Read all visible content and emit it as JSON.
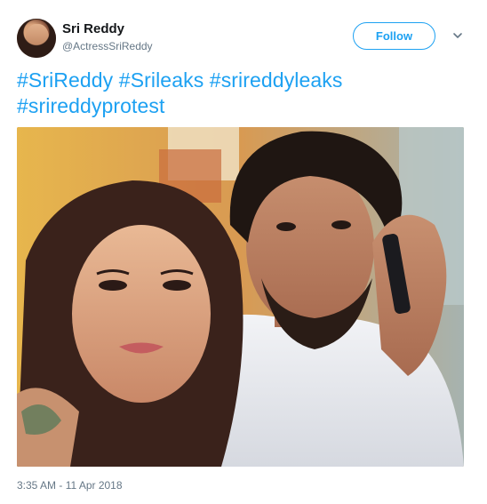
{
  "user": {
    "display_name": "Sri Reddy",
    "handle": "@ActressSriReddy"
  },
  "follow_button": {
    "label": "Follow"
  },
  "tweet": {
    "hashtags": [
      "#SriReddy",
      "#Srileaks",
      "#srireddyleaks",
      "#srireddyprotest"
    ],
    "timestamp": "3:35 AM - 11 Apr 2018"
  },
  "colors": {
    "accent": "#1da1f2",
    "secondary_text": "#657786",
    "primary_text": "#14171a"
  },
  "icons": {
    "menu": "chevron-down-icon"
  }
}
